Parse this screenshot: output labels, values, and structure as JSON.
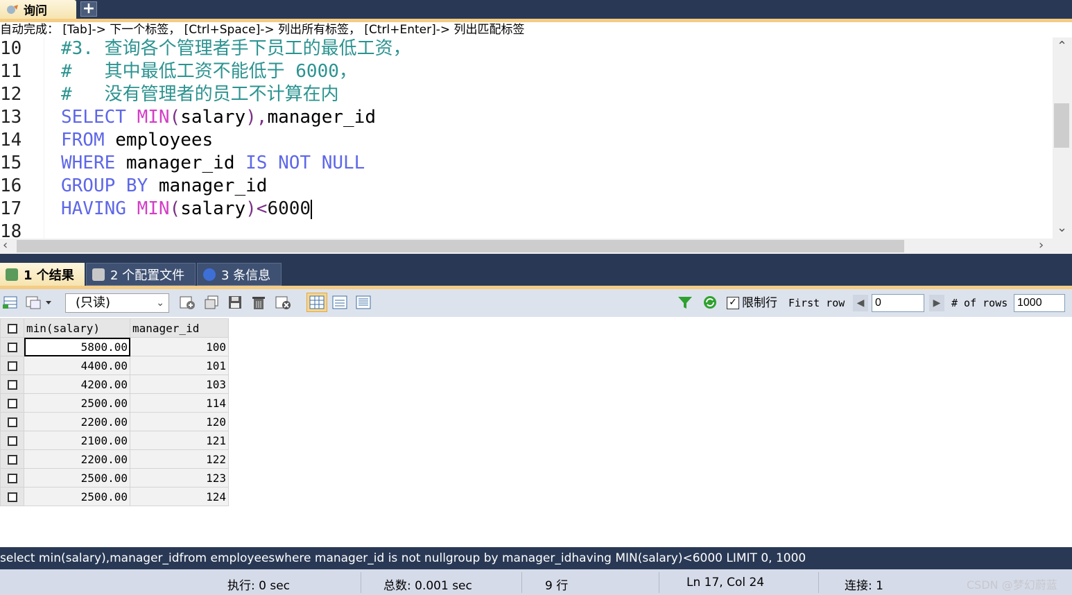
{
  "tabs": {
    "query_label": "询问",
    "add_label": "+"
  },
  "editor": {
    "autocomplete_hint": "自动完成： [Tab]-> 下一个标签， [Ctrl+Space]-> 列出所有标签， [Ctrl+Enter]-> 列出匹配标签",
    "lines": [
      {
        "num": "10",
        "parts": [
          {
            "t": "#3. 查询各个管理者手下员工的最低工资，",
            "c": "comment"
          }
        ]
      },
      {
        "num": "11",
        "parts": [
          {
            "t": "#   其中最低工资不能低于 6000，",
            "c": "comment"
          }
        ]
      },
      {
        "num": "12",
        "parts": [
          {
            "t": "#   没有管理者的员工不计算在内",
            "c": "comment"
          }
        ]
      },
      {
        "num": "13",
        "parts": [
          {
            "t": "SELECT",
            "c": "kw"
          },
          {
            "t": " ",
            "c": ""
          },
          {
            "t": "MIN",
            "c": "fn"
          },
          {
            "t": "(",
            "c": "punct"
          },
          {
            "t": "salary",
            "c": ""
          },
          {
            "t": ")",
            "c": "punct"
          },
          {
            "t": ",",
            "c": "punct"
          },
          {
            "t": "manager_id",
            "c": ""
          }
        ]
      },
      {
        "num": "14",
        "parts": [
          {
            "t": "FROM",
            "c": "kw"
          },
          {
            "t": " employees",
            "c": ""
          }
        ]
      },
      {
        "num": "15",
        "parts": [
          {
            "t": "WHERE",
            "c": "kw"
          },
          {
            "t": " manager_id ",
            "c": ""
          },
          {
            "t": "IS NOT NULL",
            "c": "kw"
          }
        ]
      },
      {
        "num": "16",
        "parts": [
          {
            "t": "GROUP BY",
            "c": "kw"
          },
          {
            "t": " manager_id",
            "c": ""
          }
        ]
      },
      {
        "num": "17",
        "parts": [
          {
            "t": "HAVING",
            "c": "kw"
          },
          {
            "t": " ",
            "c": ""
          },
          {
            "t": "MIN",
            "c": "fn"
          },
          {
            "t": "(",
            "c": "punct"
          },
          {
            "t": "salary",
            "c": ""
          },
          {
            "t": ")",
            "c": "punct"
          },
          {
            "t": "<",
            "c": "punct"
          },
          {
            "t": "6000",
            "c": "num"
          }
        ]
      },
      {
        "num": "18",
        "parts": []
      }
    ]
  },
  "result_tabs": [
    {
      "label": "1 个结果"
    },
    {
      "label": "2 个配置文件"
    },
    {
      "label": "3 条信息"
    }
  ],
  "toolbar": {
    "mode_select": "(只读)",
    "limit_label": "限制行",
    "limit_checked": true,
    "first_row_label": "First row",
    "first_row_value": "0",
    "rows_label": "# of rows",
    "rows_value": "1000"
  },
  "grid": {
    "columns": [
      "min(salary)",
      "manager_id"
    ],
    "rows": [
      [
        "5800.00",
        "100"
      ],
      [
        "4400.00",
        "101"
      ],
      [
        "4200.00",
        "103"
      ],
      [
        "2500.00",
        "114"
      ],
      [
        "2200.00",
        "120"
      ],
      [
        "2100.00",
        "121"
      ],
      [
        "2200.00",
        "122"
      ],
      [
        "2500.00",
        "123"
      ],
      [
        "2500.00",
        "124"
      ]
    ]
  },
  "sql_status": "select min(salary),manager_idfrom employeeswhere manager_id is not nullgroup by manager_idhaving MIN(salary)<6000 LIMIT 0, 1000",
  "statusbar": {
    "exec": "执行: 0 sec",
    "total": "总数: 0.001 sec",
    "rows": "9 行",
    "position": "Ln 17, Col 24",
    "connections": "连接: 1",
    "watermark": "CSDN @梦幻蔚蓝"
  },
  "colors": {
    "keyword": "#5e67e8",
    "function": "#d33fc6",
    "comment": "#2b9390",
    "chrome": "#293955",
    "accent": "#f5cc84"
  }
}
